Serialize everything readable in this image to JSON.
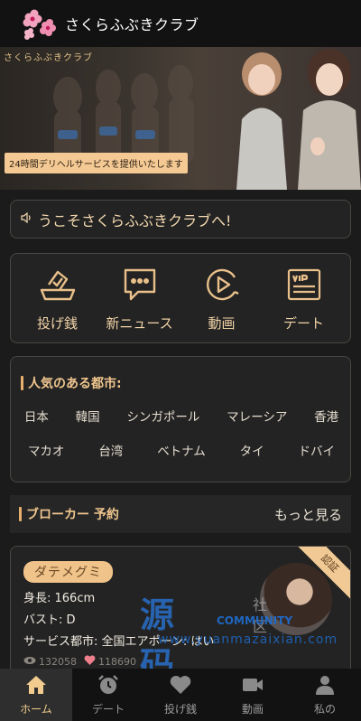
{
  "header": {
    "title": "さくらふぶきクラブ"
  },
  "banner": {
    "brand": "さくらふぶきクラブ",
    "caption": "24時間デリヘルサービスを提供いたします"
  },
  "notice": {
    "icon": "speaker-icon",
    "text": "うこそさくらふぶきクラブへ!"
  },
  "quick_menu": [
    {
      "label": "投げ銭",
      "icon": "ballot-box-icon"
    },
    {
      "label": "新ニュース",
      "icon": "chat-bubble-icon"
    },
    {
      "label": "動画",
      "icon": "play-circle-icon"
    },
    {
      "label": "デート",
      "icon": "vip-ticket-icon"
    }
  ],
  "cities": {
    "title": "人気のある都市:",
    "row1": [
      "日本",
      "韓国",
      "シンガポール",
      "マレーシア",
      "香港"
    ],
    "row2": [
      "マカオ",
      "台湾",
      "ベトナム",
      "タイ",
      "ドバイ"
    ]
  },
  "broker": {
    "title": "ブローカー 予約",
    "more": "もっと見る"
  },
  "card": {
    "name": "ダテメグミ",
    "badge": "認証",
    "height": "身長: 166cm",
    "bust": "バスト: D",
    "service_city": "サービス都市:  全国エアポーン: はい",
    "views": "132058",
    "likes": "118690"
  },
  "watermark": {
    "big": "源码",
    "small": "社区",
    "en": "COMMUNITY",
    "url": "www.yuanmazaixian.com"
  },
  "tabbar": [
    {
      "label": "ホーム",
      "icon": "home-icon",
      "active": true
    },
    {
      "label": "デート",
      "icon": "alarm-clock-icon",
      "active": false
    },
    {
      "label": "投げ銭",
      "icon": "heart-icon",
      "active": false
    },
    {
      "label": "動画",
      "icon": "video-camera-icon",
      "active": false
    },
    {
      "label": "私の",
      "icon": "person-icon",
      "active": false
    }
  ],
  "colors": {
    "accent": "#f0c68e",
    "background": "#1b1b1b",
    "card": "#232323"
  }
}
